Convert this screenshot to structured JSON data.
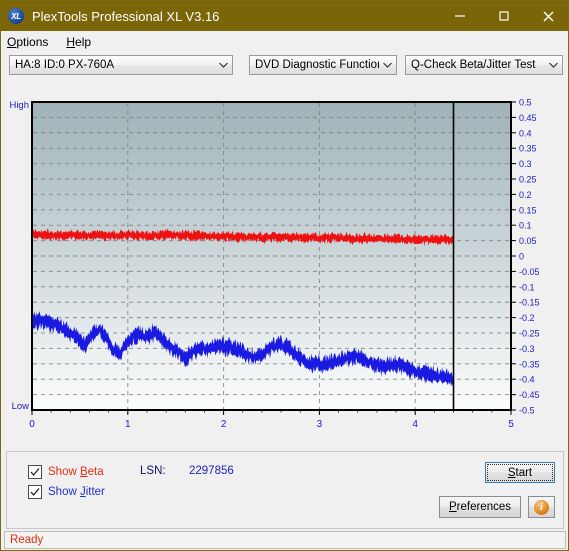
{
  "window": {
    "title": "PlexTools Professional XL V3.16",
    "app_icon": "xl-logo-icon",
    "minimize_label": "─",
    "maximize_label": "□",
    "close_label": "✕"
  },
  "menu": {
    "items": [
      {
        "label": "Options",
        "accel": "O"
      },
      {
        "label": "Help",
        "accel": "H"
      }
    ]
  },
  "toolbar": {
    "drive_selector": "HA:8 ID:0  PX-760A",
    "function_selector": "DVD Diagnostic Functions",
    "test_selector": "Q-Check Beta/Jitter Test"
  },
  "controls": {
    "show_beta_label_pre": "Show ",
    "show_beta_label_accel": "B",
    "show_beta_label_post": "eta",
    "show_beta_checked": true,
    "show_jitter_label_pre": "Show ",
    "show_jitter_label_accel": "J",
    "show_jitter_label_post": "itter",
    "show_jitter_checked": true,
    "lsn_label": "LSN:",
    "lsn_value": "2297856",
    "start_label_pre": "",
    "start_label_accel": "S",
    "start_label_post": "tart",
    "preferences_label_pre": "",
    "preferences_label_accel": "P",
    "preferences_label_post": "references",
    "info_label": "i"
  },
  "status": {
    "text": "Ready"
  },
  "colors": {
    "titlebar": "#7a6608",
    "beta_trace": "#ee1111",
    "jitter_trace": "#1a1ae0",
    "plot_top": "#9fb2b8",
    "plot_bottom": "#fcfdfd",
    "axis": "#000000",
    "grid": "#808080",
    "label_blue": "#2020c0",
    "status_red": "#e03010"
  },
  "chart_data": {
    "type": "line",
    "title": "",
    "xlabel": "",
    "ylabel": "",
    "xlim": [
      0,
      5
    ],
    "ylim": [
      -0.5,
      0.5
    ],
    "xticks": [
      0,
      1,
      2,
      3,
      4,
      5
    ],
    "yticks": [
      0.5,
      0.45,
      0.4,
      0.35,
      0.3,
      0.25,
      0.2,
      0.15,
      0.1,
      0.05,
      0,
      -0.05,
      -0.1,
      -0.15,
      -0.2,
      -0.25,
      -0.3,
      -0.35,
      -0.4,
      -0.45,
      -0.5
    ],
    "grid": true,
    "grid_style": "dashed",
    "edge_labels": {
      "top_left": "High",
      "bottom_left": "Low"
    },
    "data_end_marker_x": 4.4,
    "legend_position": "below-plot-as-checkboxes",
    "series": [
      {
        "name": "Beta",
        "color": "#ee1111",
        "noise": 0.012,
        "x": [
          0.0,
          0.1,
          0.2,
          0.3,
          0.4,
          0.5,
          0.6,
          0.7,
          0.8,
          0.9,
          1.0,
          1.1,
          1.2,
          1.3,
          1.4,
          1.5,
          1.6,
          1.7,
          1.8,
          1.9,
          2.0,
          2.1,
          2.2,
          2.3,
          2.4,
          2.5,
          2.6,
          2.7,
          2.8,
          2.9,
          3.0,
          3.1,
          3.2,
          3.3,
          3.4,
          3.5,
          3.6,
          3.7,
          3.8,
          3.9,
          4.0,
          4.1,
          4.2,
          4.3,
          4.4
        ],
        "values": [
          0.07,
          0.068,
          0.069,
          0.067,
          0.068,
          0.066,
          0.067,
          0.068,
          0.066,
          0.067,
          0.068,
          0.066,
          0.067,
          0.068,
          0.069,
          0.068,
          0.066,
          0.065,
          0.066,
          0.067,
          0.065,
          0.063,
          0.062,
          0.062,
          0.061,
          0.062,
          0.061,
          0.06,
          0.061,
          0.06,
          0.058,
          0.059,
          0.06,
          0.058,
          0.057,
          0.056,
          0.057,
          0.056,
          0.055,
          0.054,
          0.054,
          0.053,
          0.054,
          0.053,
          0.053
        ]
      },
      {
        "name": "Jitter",
        "color": "#1a1ae0",
        "noise": 0.02,
        "x": [
          0.0,
          0.07,
          0.14,
          0.21,
          0.28,
          0.35,
          0.42,
          0.49,
          0.56,
          0.63,
          0.7,
          0.77,
          0.84,
          0.91,
          0.98,
          1.05,
          1.12,
          1.19,
          1.26,
          1.33,
          1.4,
          1.47,
          1.54,
          1.61,
          1.68,
          1.75,
          1.82,
          1.89,
          1.96,
          2.03,
          2.1,
          2.17,
          2.24,
          2.31,
          2.38,
          2.45,
          2.52,
          2.59,
          2.66,
          2.73,
          2.8,
          2.87,
          2.94,
          3.01,
          3.08,
          3.15,
          3.22,
          3.29,
          3.36,
          3.43,
          3.5,
          3.57,
          3.64,
          3.71,
          3.78,
          3.85,
          3.92,
          3.99,
          4.06,
          4.13,
          4.2,
          4.27,
          4.34,
          4.4
        ],
        "values": [
          -0.21,
          -0.208,
          -0.212,
          -0.218,
          -0.228,
          -0.24,
          -0.252,
          -0.268,
          -0.292,
          -0.252,
          -0.238,
          -0.262,
          -0.3,
          -0.322,
          -0.286,
          -0.262,
          -0.252,
          -0.262,
          -0.25,
          -0.258,
          -0.282,
          -0.3,
          -0.315,
          -0.33,
          -0.312,
          -0.3,
          -0.302,
          -0.296,
          -0.292,
          -0.296,
          -0.3,
          -0.31,
          -0.322,
          -0.33,
          -0.322,
          -0.305,
          -0.292,
          -0.288,
          -0.296,
          -0.312,
          -0.332,
          -0.344,
          -0.352,
          -0.356,
          -0.35,
          -0.344,
          -0.336,
          -0.33,
          -0.326,
          -0.332,
          -0.342,
          -0.352,
          -0.358,
          -0.356,
          -0.352,
          -0.356,
          -0.364,
          -0.372,
          -0.378,
          -0.382,
          -0.386,
          -0.392,
          -0.398,
          -0.4
        ]
      }
    ]
  }
}
